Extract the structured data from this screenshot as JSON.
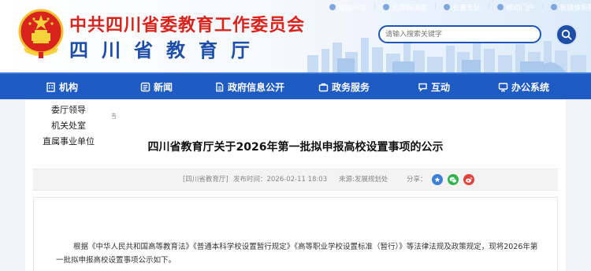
{
  "header": {
    "title_cn": "中共四川省委教育工作委员会",
    "title_sub": "四川省教育厅",
    "top_links": [
      "智能问答",
      "无障碍浏览",
      "长者专区",
      "移动门户",
      "新媒体矩阵"
    ],
    "search_placeholder": "请输入搜索关键字"
  },
  "nav": {
    "items": [
      {
        "label": "机构",
        "icon": "building-icon"
      },
      {
        "label": "新闻",
        "icon": "news-icon"
      },
      {
        "label": "政府信息公开",
        "icon": "info-disclosure-icon"
      },
      {
        "label": "政务服务",
        "icon": "service-icon"
      },
      {
        "label": "互动",
        "icon": "chat-icon"
      },
      {
        "label": "办公系统",
        "icon": "office-icon"
      }
    ]
  },
  "dropdown": {
    "items": [
      "委厅领导",
      "机关处室",
      "直属事业单位"
    ]
  },
  "content": {
    "breadcrumb": "告",
    "title": "四川省教育厅关于2026年第一批拟申报高校设置事项的公示",
    "meta": {
      "source": "[四川省教育厅]",
      "date": "发布时间：2026-02-11 18:03",
      "origin": "来源:发展规划处",
      "share_label": "分享："
    },
    "share_icons": [
      "star-share-icon",
      "wechat-icon",
      "weibo-icon"
    ],
    "paragraph_line1": "根据《中华人民共和国高等教育法》《普通本科学校设置暂行规定》《高等职业学校设置标准（暂行）》等法律法规及政策规定，现将2026年第",
    "paragraph_line2": "一批拟申报高校设置事项公示如下。"
  },
  "colors": {
    "brand_blue": "#1e5cc4",
    "title_red": "#d8241d",
    "subtitle_blue": "#1d4ea8"
  }
}
